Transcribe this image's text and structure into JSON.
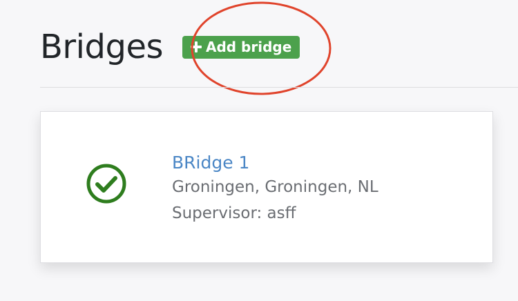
{
  "header": {
    "title": "Bridges",
    "add_button_label": "Add bridge"
  },
  "bridges": [
    {
      "name": "BRidge 1",
      "location": "Groningen, Groningen, NL",
      "supervisor": "Supervisor: asff",
      "status_icon": "check-circle-icon"
    }
  ],
  "colors": {
    "accent_green": "#4ca14c",
    "status_green": "#2e7d1e",
    "link_blue": "#4a86c5",
    "annotation_red": "#e0442c"
  }
}
